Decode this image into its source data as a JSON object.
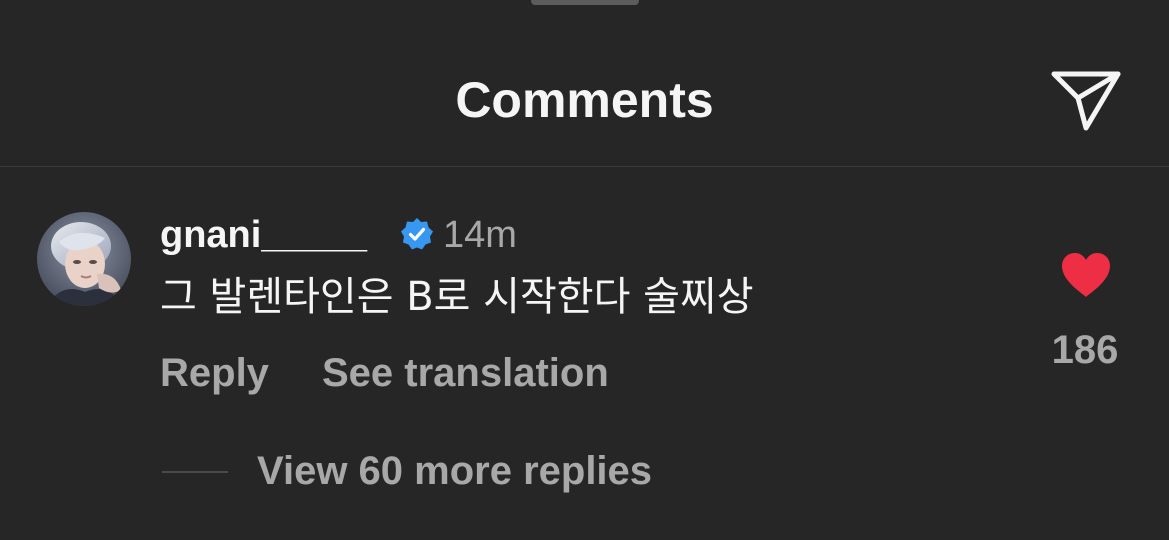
{
  "header": {
    "title": "Comments",
    "share_icon": "send-paper-plane-icon"
  },
  "comment": {
    "username": "gnani_____",
    "verified_icon": "verified-badge-icon",
    "verified_color": "#3897f0",
    "timestamp": "14m",
    "text": "그 발렌타인은 B로 시작한다 술찌상",
    "reply_label": "Reply",
    "translate_label": "See translation",
    "like_icon": "heart-filled-icon",
    "like_color": "#ed2e45",
    "like_count": "186",
    "view_replies_label": "View 60 more replies"
  },
  "colors": {
    "background": "#262626",
    "primary_text": "#f5f5f5",
    "secondary_text": "#a8a8a8"
  }
}
